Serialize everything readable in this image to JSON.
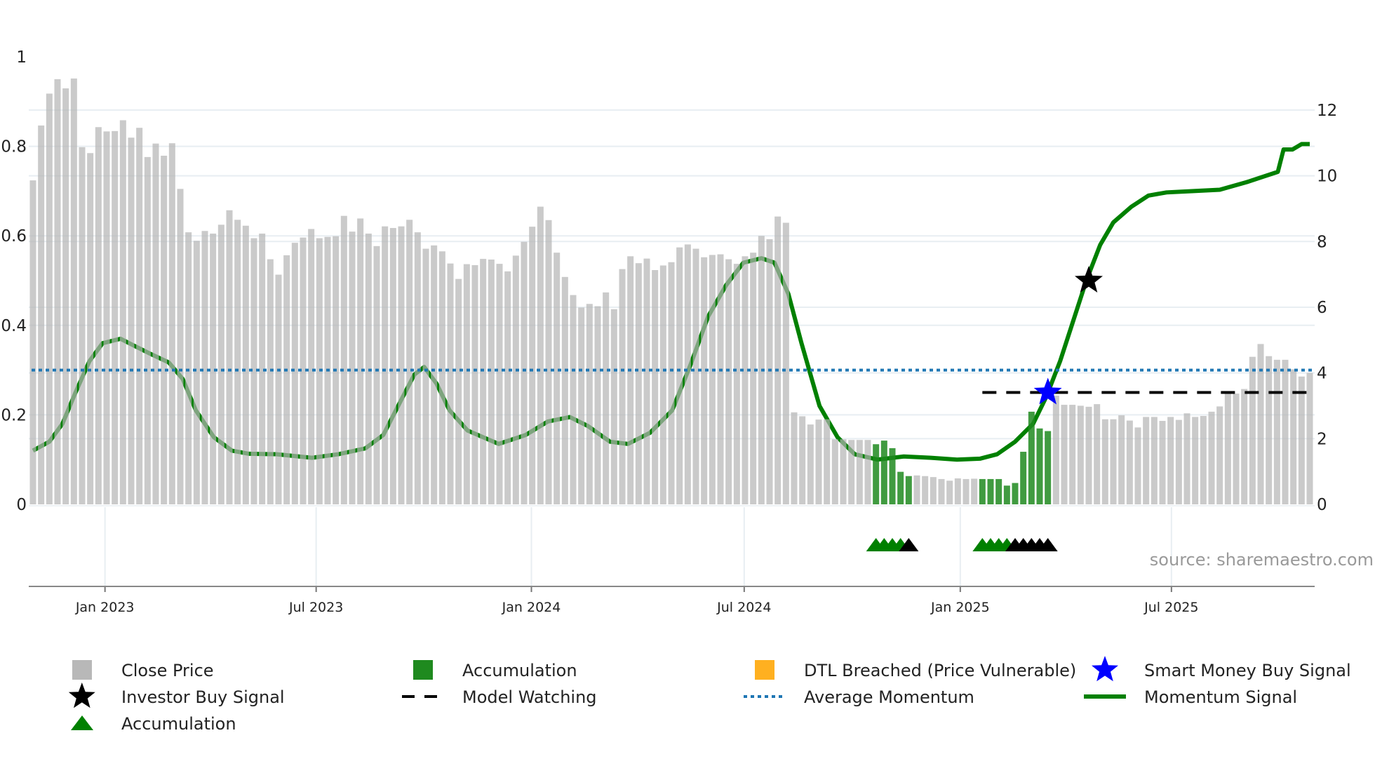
{
  "chart_data": {
    "type": "bar+line",
    "title": "",
    "left_axis": {
      "range": [
        0,
        1
      ],
      "ticks": [
        "0",
        "0.2",
        "0.4",
        "0.6",
        "0.8",
        "1"
      ],
      "tick_values": [
        0,
        0.2,
        0.4,
        0.6,
        0.8,
        1
      ]
    },
    "right_axis": {
      "range": [
        0,
        13.62
      ],
      "ticks": [
        "0",
        "2",
        "4",
        "6",
        "8",
        "10",
        "12"
      ],
      "tick_values": [
        0,
        2,
        4,
        6,
        8,
        10,
        12
      ]
    },
    "x_axis": {
      "unit": "bar index (weekly)",
      "range": [
        0,
        156
      ],
      "ticks": [
        {
          "label": "Jan 2023",
          "index": 8.8
        },
        {
          "label": "Jul 2023",
          "index": 34.6
        },
        {
          "label": "Jan 2024",
          "index": 60.9
        },
        {
          "label": "Jul 2024",
          "index": 86.9
        },
        {
          "label": "Jan 2025",
          "index": 113.3
        },
        {
          "label": "Jul 2025",
          "index": 139.1
        }
      ]
    },
    "close_price": [
      9.86,
      11.53,
      12.5,
      12.94,
      12.66,
      12.96,
      10.87,
      10.69,
      11.48,
      11.35,
      11.36,
      11.69,
      11.16,
      11.46,
      10.57,
      10.98,
      10.61,
      10.99,
      9.6,
      8.28,
      8.02,
      8.32,
      8.24,
      8.51,
      8.95,
      8.66,
      8.48,
      8.1,
      8.24,
      7.46,
      6.99,
      7.58,
      7.96,
      8.12,
      8.38,
      8.1,
      8.14,
      8.16,
      8.78,
      8.3,
      8.7,
      8.24,
      7.86,
      8.46,
      8.41,
      8.46,
      8.66,
      8.28,
      7.78,
      7.88,
      7.7,
      7.33,
      6.86,
      7.31,
      7.28,
      7.47,
      7.45,
      7.32,
      7.09,
      7.57,
      7.99,
      8.45,
      9.06,
      8.65,
      7.66,
      6.92,
      6.37,
      5.99,
      6.1,
      6.03,
      6.45,
      5.94,
      7.16,
      7.55,
      7.34,
      7.48,
      7.13,
      7.27,
      7.37,
      7.82,
      7.91,
      7.78,
      7.52,
      7.59,
      7.61,
      7.46,
      7.32,
      7.55,
      7.66,
      8.17,
      8.07,
      8.76,
      8.57,
      2.8,
      2.68,
      2.43,
      2.58,
      2.59,
      1.98,
      1.98,
      1.96,
      1.96,
      1.96,
      1.83,
      1.94,
      1.71,
      0.99,
      0.86,
      0.88,
      0.86,
      0.83,
      0.77,
      0.72,
      0.79,
      0.77,
      0.78,
      0.77,
      0.77,
      0.77,
      0.57,
      0.65,
      1.6,
      2.82,
      2.31,
      2.23,
      3.31,
      3.03,
      3.03,
      3.0,
      2.97,
      3.05,
      2.59,
      2.59,
      2.71,
      2.55,
      2.34,
      2.66,
      2.66,
      2.54,
      2.66,
      2.57,
      2.77,
      2.66,
      2.69,
      2.82,
      2.98,
      3.39,
      3.37,
      3.51,
      4.49,
      4.88,
      4.51,
      4.4,
      4.4,
      4.11,
      3.89,
      4.0
    ],
    "accumulation_bar_indices": [
      103,
      104,
      105,
      106,
      107,
      116,
      117,
      118,
      119,
      120,
      121,
      122,
      123,
      124
    ],
    "momentum_signal": [
      [
        0,
        0.12
      ],
      [
        2,
        0.14
      ],
      [
        3.6,
        0.18
      ],
      [
        5.2,
        0.25
      ],
      [
        6.9,
        0.32
      ],
      [
        8.5,
        0.36
      ],
      [
        10.7,
        0.37
      ],
      [
        12.3,
        0.355
      ],
      [
        14.5,
        0.335
      ],
      [
        16.6,
        0.317
      ],
      [
        18.3,
        0.28
      ],
      [
        19.9,
        0.21
      ],
      [
        22.1,
        0.15
      ],
      [
        24.3,
        0.12
      ],
      [
        26.4,
        0.113
      ],
      [
        29.7,
        0.112
      ],
      [
        34.1,
        0.104
      ],
      [
        37.3,
        0.112
      ],
      [
        40.6,
        0.125
      ],
      [
        42.8,
        0.155
      ],
      [
        44.9,
        0.23
      ],
      [
        46.6,
        0.29
      ],
      [
        47.8,
        0.307
      ],
      [
        49.3,
        0.27
      ],
      [
        50.9,
        0.21
      ],
      [
        53.1,
        0.165
      ],
      [
        56.9,
        0.135
      ],
      [
        60.2,
        0.155
      ],
      [
        62.9,
        0.185
      ],
      [
        65.6,
        0.195
      ],
      [
        67.8,
        0.175
      ],
      [
        70.5,
        0.14
      ],
      [
        72.7,
        0.135
      ],
      [
        75.4,
        0.16
      ],
      [
        78.1,
        0.21
      ],
      [
        80.3,
        0.31
      ],
      [
        82.5,
        0.42
      ],
      [
        84.7,
        0.49
      ],
      [
        86.8,
        0.54
      ],
      [
        89,
        0.55
      ],
      [
        90.6,
        0.54
      ],
      [
        92.3,
        0.47
      ],
      [
        93.9,
        0.36
      ],
      [
        96.1,
        0.22
      ],
      [
        98.3,
        0.15
      ],
      [
        100.4,
        0.112
      ],
      [
        103.2,
        0.1
      ],
      [
        106.4,
        0.107
      ],
      [
        109.7,
        0.104
      ],
      [
        112.9,
        0.1
      ],
      [
        115.7,
        0.102
      ],
      [
        117.8,
        0.112
      ],
      [
        120,
        0.14
      ],
      [
        122.2,
        0.18
      ],
      [
        123.8,
        0.24
      ],
      [
        125.5,
        0.32
      ],
      [
        127.1,
        0.41
      ],
      [
        128.7,
        0.5
      ],
      [
        130.4,
        0.58
      ],
      [
        132,
        0.63
      ],
      [
        134.2,
        0.665
      ],
      [
        136.3,
        0.69
      ],
      [
        138.5,
        0.697
      ],
      [
        141.8,
        0.7
      ],
      [
        145,
        0.703
      ],
      [
        148.3,
        0.72
      ],
      [
        152.1,
        0.743
      ],
      [
        152.8,
        0.793
      ],
      [
        153.9,
        0.793
      ],
      [
        155,
        0.805
      ],
      [
        156,
        0.805
      ]
    ],
    "average_momentum": 0.3,
    "model_watching": {
      "from_index": 116,
      "to_index": 156,
      "value_left_axis": 0.25
    },
    "smart_money_buy_signal": {
      "index": 124,
      "value_left_axis": 0.25
    },
    "investor_buy_signal": {
      "index": 129,
      "value_left_axis": 0.5
    },
    "accumulation_markers": {
      "green": [
        103,
        104,
        105,
        106,
        116,
        117,
        118,
        119
      ],
      "black": [
        107,
        120,
        121,
        122,
        123,
        124
      ]
    },
    "legend": [
      {
        "label": "Close Price",
        "kind": "square",
        "color": "#b8b8b8"
      },
      {
        "label": "Accumulation",
        "kind": "square",
        "color": "#1f8a1f"
      },
      {
        "label": "DTL Breached (Price Vulnerable)",
        "kind": "square",
        "color": "#ffb020"
      },
      {
        "label": "Smart Money Buy Signal",
        "kind": "star",
        "color": "#0000ff"
      },
      {
        "label": "Investor Buy Signal",
        "kind": "star",
        "color": "#000000"
      },
      {
        "label": "Model Watching",
        "kind": "dash",
        "color": "#000000"
      },
      {
        "label": "Average Momentum",
        "kind": "dot",
        "color": "#1f77b4"
      },
      {
        "label": "Momentum Signal",
        "kind": "line",
        "color": "#008000"
      },
      {
        "label": "Accumulation",
        "kind": "triangle",
        "color": "#008000"
      }
    ],
    "legend_placement": "bottom",
    "grid": true
  },
  "source_note": "source: sharemaestro.com",
  "colors": {
    "bar": "#b4b4b4",
    "accum_bar": "#1f8a1f",
    "momentum": "#008000",
    "avg": "#1f77b4",
    "grid": "#e8eef2"
  }
}
